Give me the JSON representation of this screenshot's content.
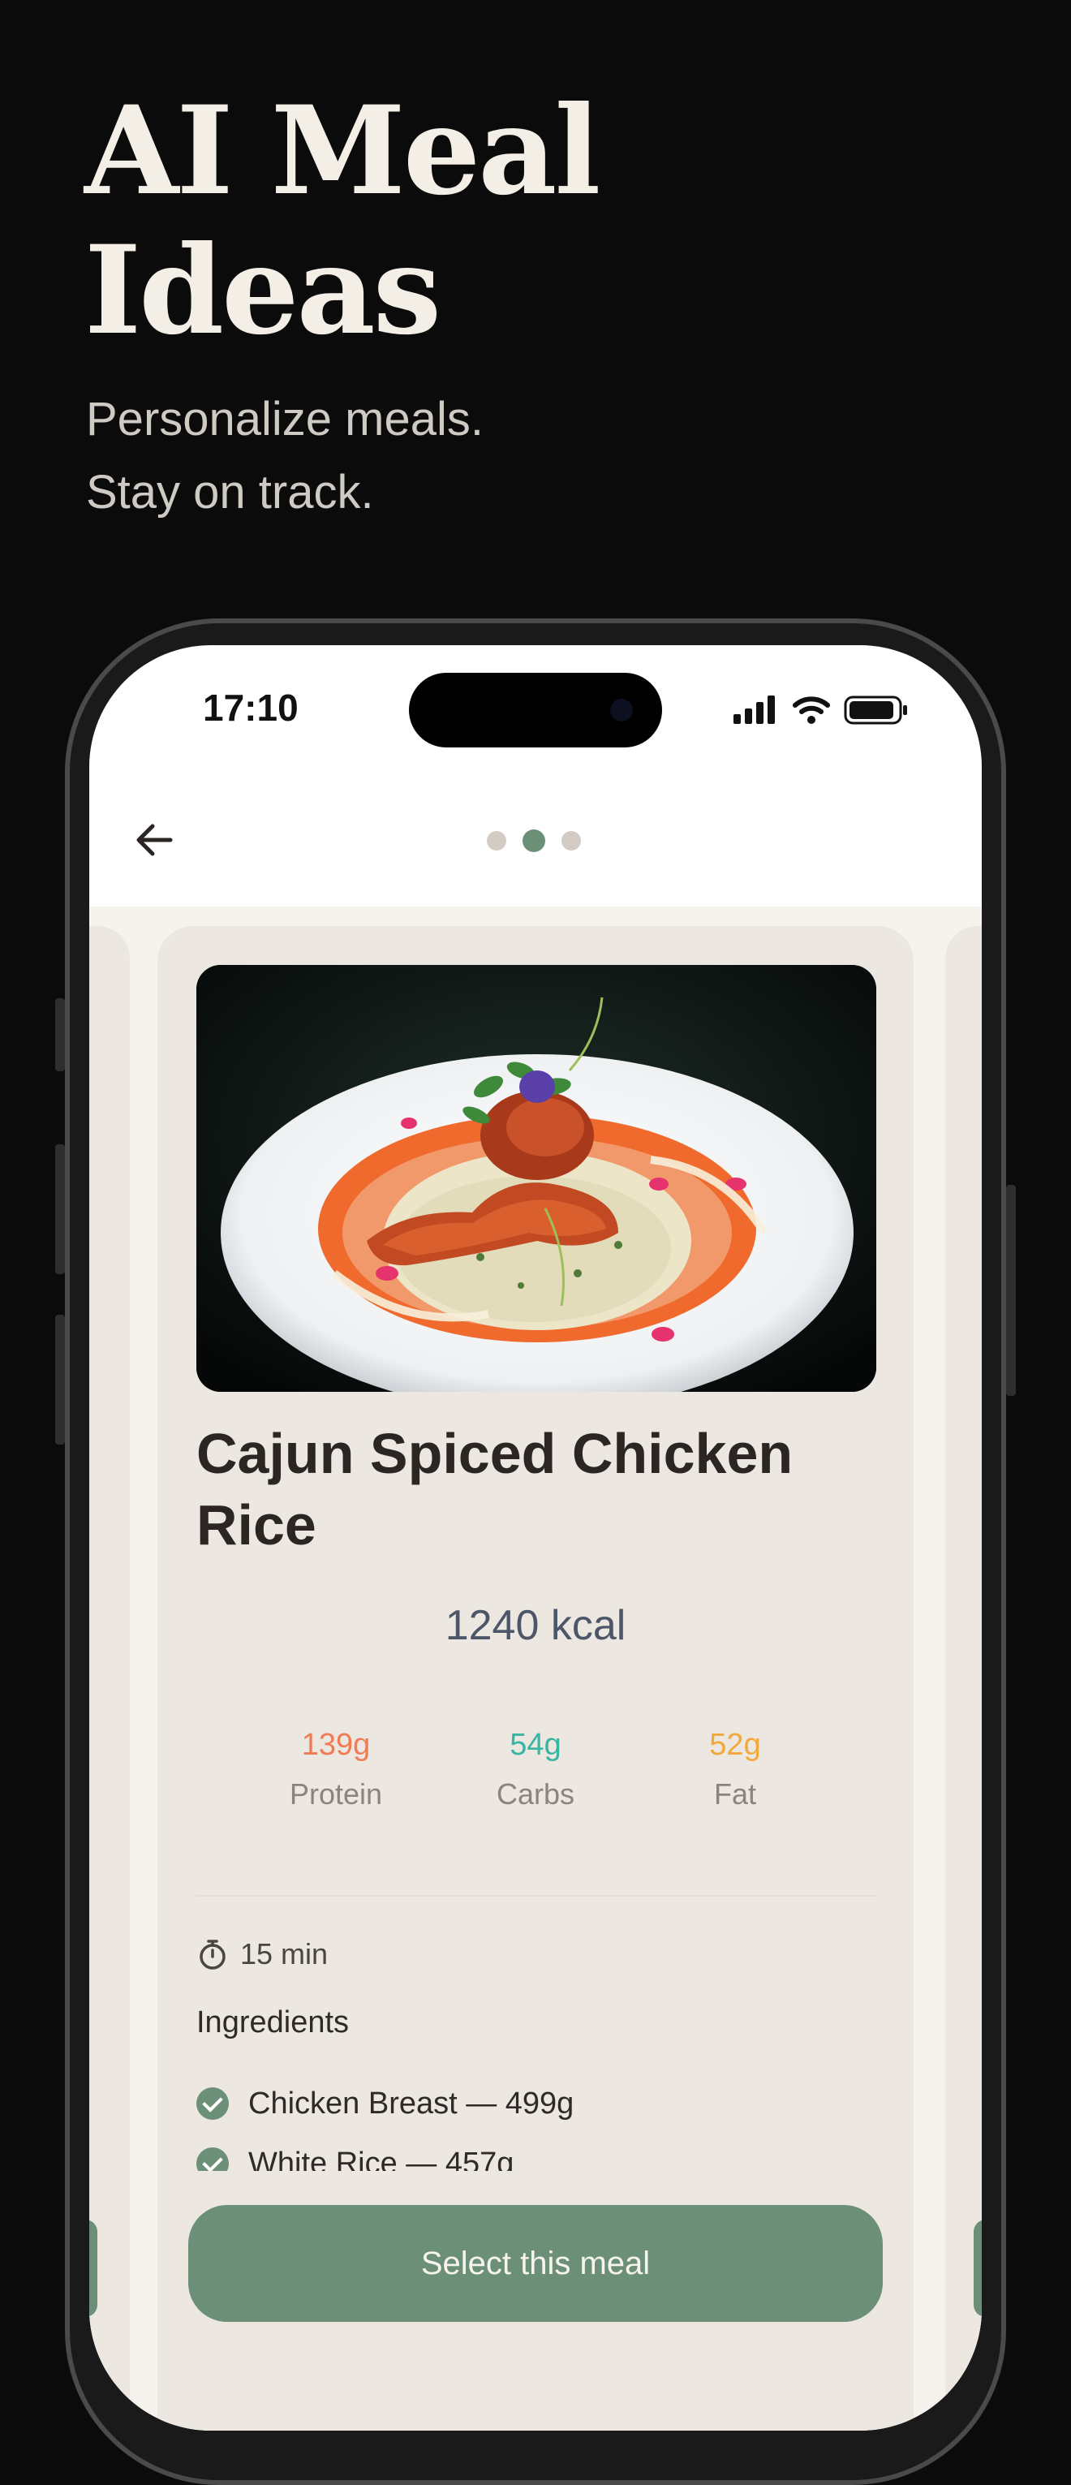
{
  "promo": {
    "title": "AI Meal Ideas",
    "subtitle_line1": "Personalize meals.",
    "subtitle_line2": "Stay on track."
  },
  "status_bar": {
    "time": "17:10"
  },
  "pager": {
    "count": 3,
    "active_index": 1
  },
  "meal": {
    "name": "Cajun Spiced Chicken Rice",
    "kcal": "1240 kcal",
    "macros": [
      {
        "value": "139g",
        "label": "Protein",
        "color": "#f07c55"
      },
      {
        "value": "54g",
        "label": "Carbs",
        "color": "#39b5a3"
      },
      {
        "value": "52g",
        "label": "Fat",
        "color": "#f2a93b"
      }
    ],
    "time": "15 min",
    "ingredients_title": "Ingredients",
    "ingredients": [
      "Chicken Breast — 499g",
      "White Rice — 457g"
    ]
  },
  "cta": {
    "label": "Select this meal"
  },
  "colors": {
    "accent": "#6c8f78",
    "card": "#ece7e1",
    "background": "#0b0b0b"
  }
}
